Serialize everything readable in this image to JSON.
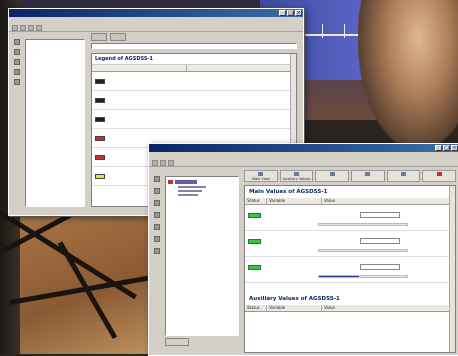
{
  "window1": {
    "title": "",
    "menu": [
      "",
      "",
      "",
      ""
    ],
    "tabs": [
      "",
      ""
    ],
    "address": "",
    "tree_root": "",
    "panel_title": "Legend of AGSDSS-1",
    "columns": [
      "",
      ""
    ],
    "legend_rows": [
      {
        "color": "#222222",
        "code": "",
        "desc": ""
      },
      {
        "color": "#222222",
        "code": "",
        "desc": ""
      },
      {
        "color": "#222222",
        "code": "",
        "desc": ""
      },
      {
        "color": "#d02828",
        "code": "",
        "desc": ""
      },
      {
        "color": "#c83030",
        "code": "",
        "desc": ""
      },
      {
        "color": "#e8e040",
        "code": "",
        "desc": ""
      }
    ]
  },
  "window2": {
    "title": "",
    "menu": [
      "",
      "",
      "",
      "",
      "",
      ""
    ],
    "ribbon": [
      {
        "label": "Main View",
        "icon": "view-icon"
      },
      {
        "label": "Auxiliary Values",
        "icon": "values-icon"
      },
      {
        "label": "",
        "icon": "chart-icon"
      },
      {
        "label": "",
        "icon": "chart-icon"
      },
      {
        "label": "",
        "icon": "chart-icon"
      },
      {
        "label": "",
        "icon": "alarm-icon"
      }
    ],
    "tree_tab": "",
    "main_title": "Main Values of AGSDSS-1",
    "main_columns": [
      "Status",
      "Variable",
      "Value"
    ],
    "main_rows": [
      {
        "status_color": "#3cc43c",
        "name": "",
        "label": "",
        "value": "",
        "unit": "",
        "bar_fraction": null
      },
      {
        "status_color": "#3cc43c",
        "name": "",
        "label": "",
        "value": "",
        "unit": "",
        "bar_fraction": null
      },
      {
        "status_color": "#3cc43c",
        "name": "",
        "label": "",
        "value": "",
        "unit": "",
        "bar_fraction": 0.45
      }
    ],
    "aux_title": "Auxiliary Values of AGSDSS-1",
    "aux_columns": [
      "Status",
      "Variable",
      "Value"
    ]
  }
}
